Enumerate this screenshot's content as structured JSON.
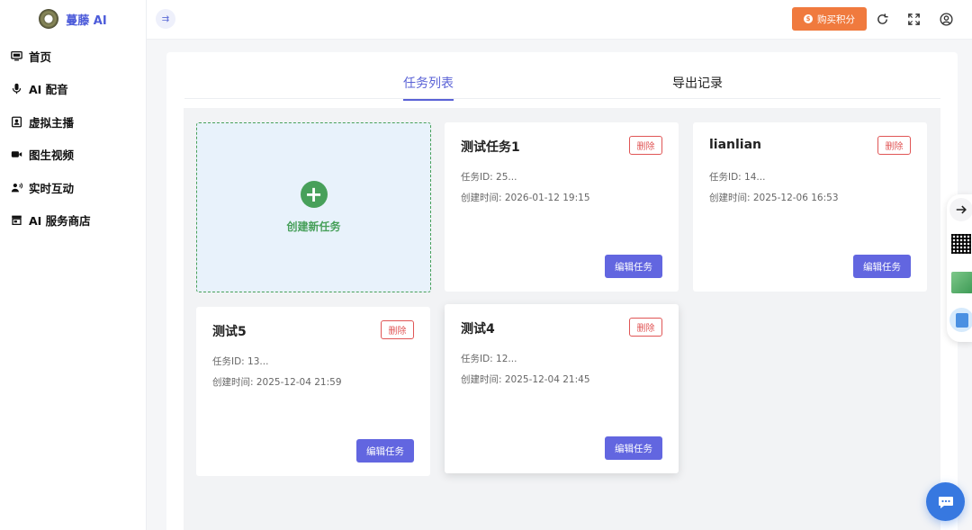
{
  "brand": {
    "name": "蔓藤 AI"
  },
  "sidebar": {
    "items": [
      {
        "label": "首页",
        "icon": "monitor-icon"
      },
      {
        "label": "AI 配音",
        "icon": "microphone-icon"
      },
      {
        "label": "虚拟主播",
        "icon": "contact-book-icon"
      },
      {
        "label": "图生视频",
        "icon": "video-camera-icon"
      },
      {
        "label": "实时互动",
        "icon": "user-voice-icon"
      },
      {
        "label": "AI 服务商店",
        "icon": "store-icon"
      }
    ]
  },
  "header": {
    "collapse_glyph": "⇉",
    "buy_label": "购买积分",
    "coin_glyph": "$"
  },
  "tabs": [
    {
      "label": "任务列表",
      "active": true
    },
    {
      "label": "导出记录",
      "active": false
    }
  ],
  "create": {
    "label": "创建新任务",
    "glyph": "+"
  },
  "tasks": [
    {
      "title": "测试任务1",
      "id_text": "任务ID: 25...",
      "time_text": "创建时间: 2026-01-12 19:15",
      "delete_label": "删除",
      "edit_label": "编辑任务"
    },
    {
      "title": "lianlian",
      "id_text": "任务ID: 14...",
      "time_text": "创建时间: 2025-12-06 16:53",
      "delete_label": "删除",
      "edit_label": "编辑任务"
    },
    {
      "title": "测试5",
      "id_text": "任务ID: 13...",
      "time_text": "创建时间: 2025-12-04 21:59",
      "delete_label": "删除",
      "edit_label": "编辑任务"
    },
    {
      "title": "测试4",
      "id_text": "任务ID: 12...",
      "time_text": "创建时间: 2025-12-04 21:45",
      "delete_label": "删除",
      "edit_label": "编辑任务"
    }
  ],
  "colors": {
    "brand": "#4c5bd9",
    "accent": "#6266e0",
    "buy": "#f07a3e",
    "danger": "#e05555",
    "create": "#47a05a",
    "chat": "#3778e0"
  }
}
